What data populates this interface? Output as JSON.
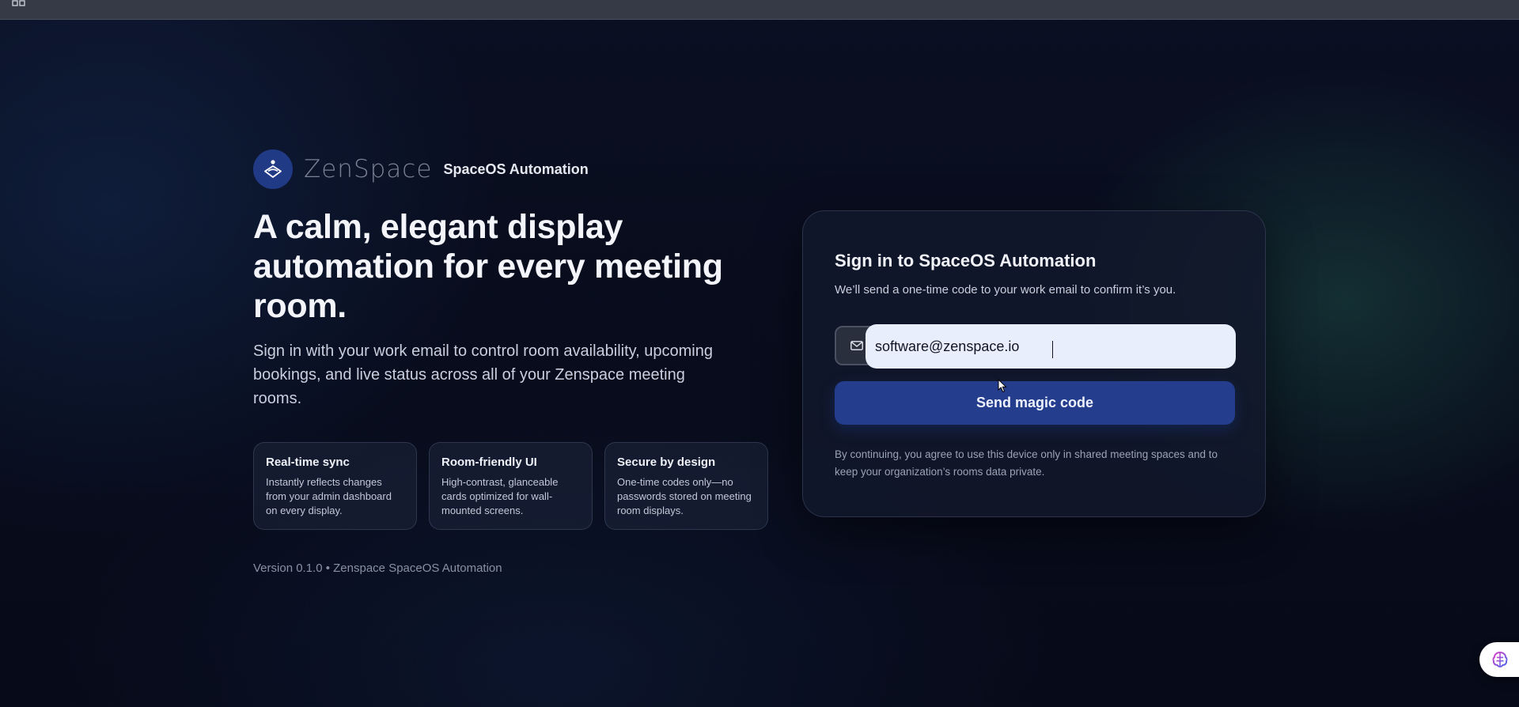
{
  "brand": {
    "wordmark": "ZenSpace",
    "product": "SpaceOS Automation",
    "logo_icon": "zenspace-logo-icon"
  },
  "hero": {
    "title": "A calm, elegant display automation for every meeting room.",
    "subtitle": "Sign in with your work email to control room availability, upcoming bookings, and live status across all of your Zenspace meeting rooms."
  },
  "features": [
    {
      "title": "Real-time sync",
      "desc": "Instantly reflects changes from your admin dashboard on every display."
    },
    {
      "title": "Room-friendly UI",
      "desc": "High-contrast, glanceable cards optimized for wall-mounted screens."
    },
    {
      "title": "Secure by design",
      "desc": "One-time codes only—no passwords stored on meeting room displays."
    }
  ],
  "version": "Version 0.1.0 • Zenspace SpaceOS Automation",
  "signin": {
    "title": "Sign in to SpaceOS Automation",
    "subtitle": "We’ll send a one-time code to your work email to confirm it’s you.",
    "email_value": "software@zenspace.io",
    "email_icon": "mail-icon",
    "button_label": "Send magic code",
    "disclaimer": "By continuing, you agree to use this device only in shared meeting spaces and to keep your organization’s rooms data private."
  },
  "colors": {
    "accent": "#253d8d",
    "logo_bg": "#213a86",
    "background": "#0a0f22"
  }
}
